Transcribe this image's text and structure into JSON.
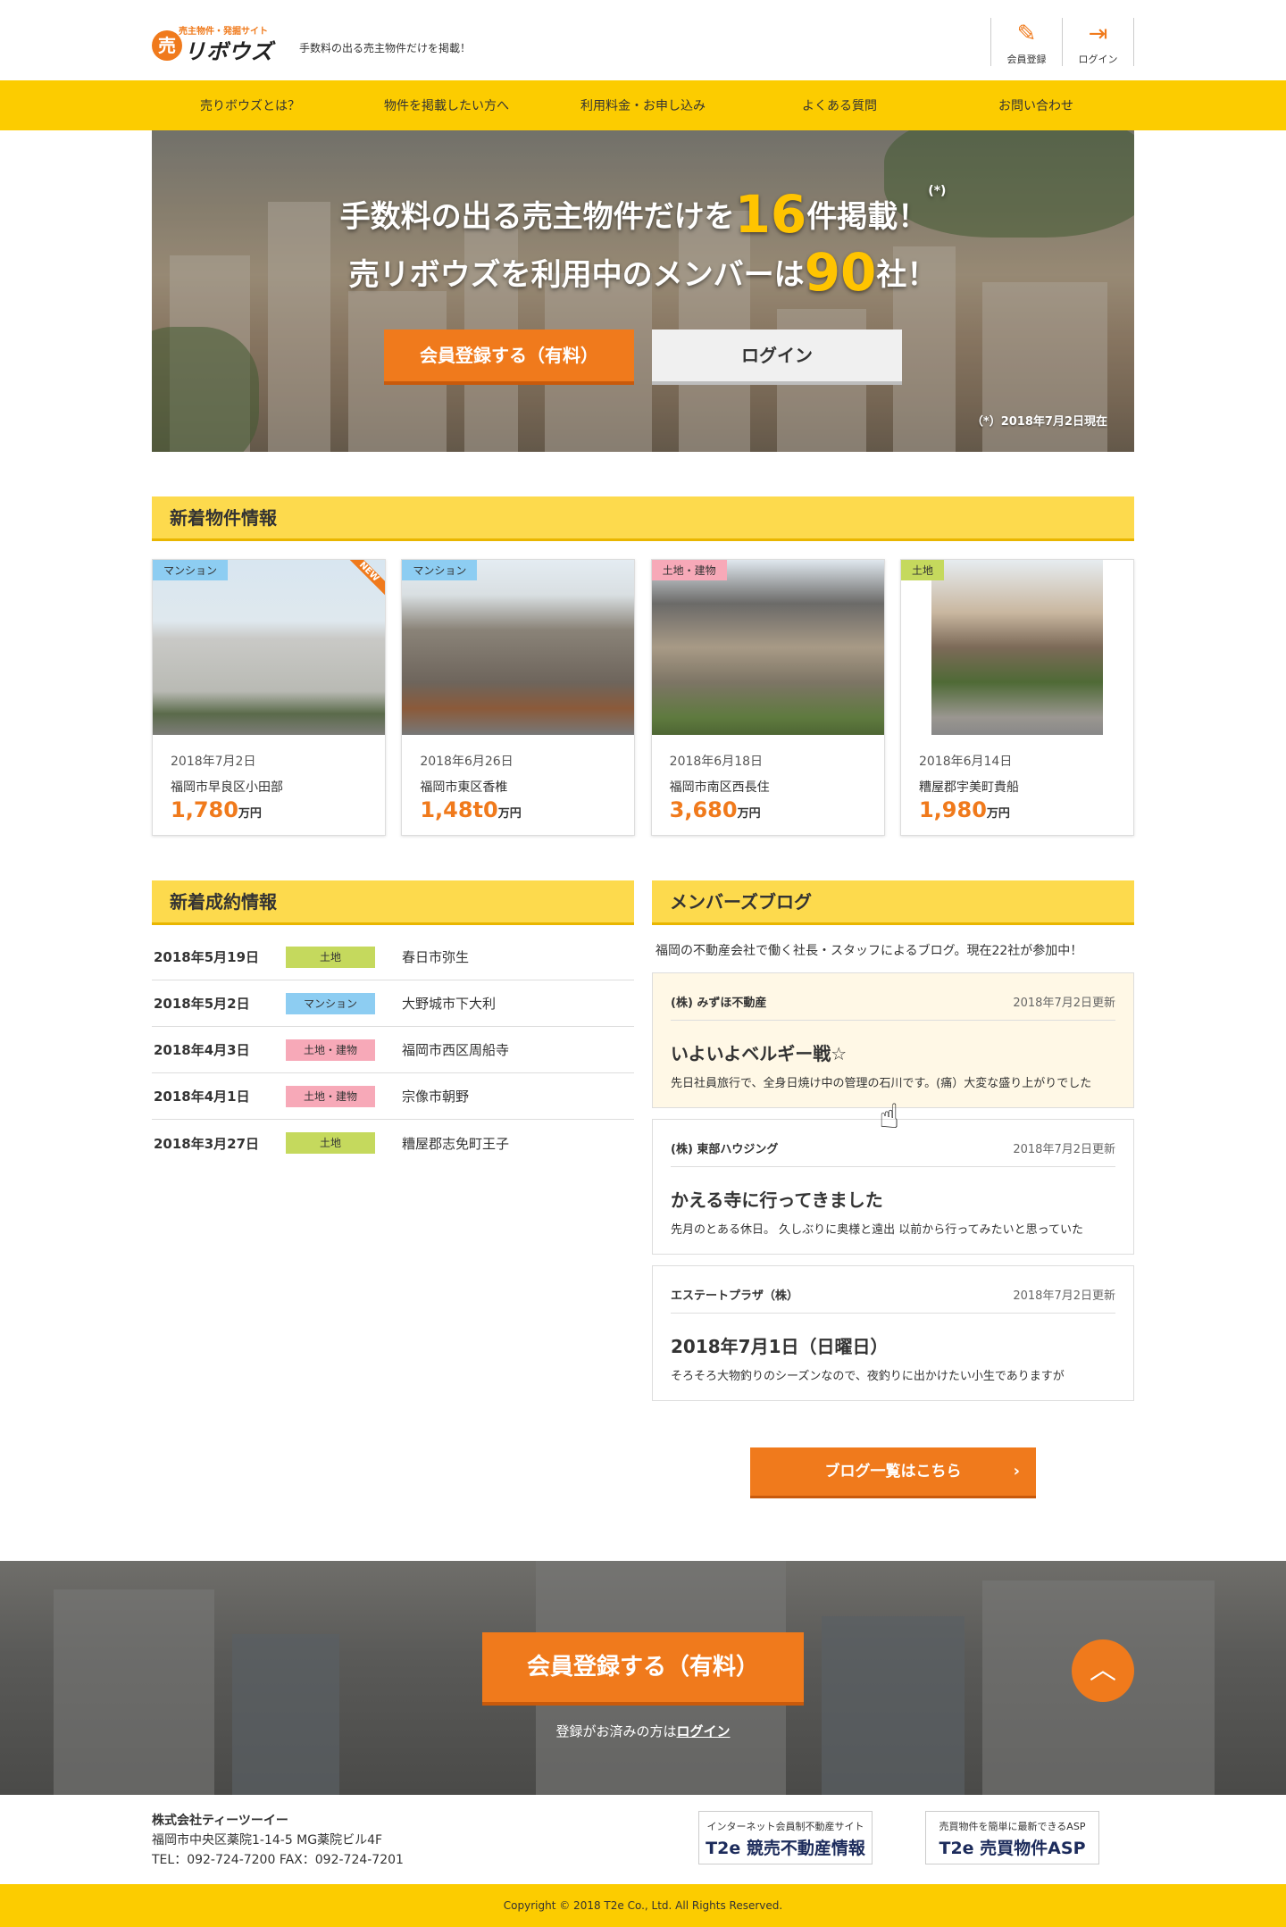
{
  "header": {
    "logo_small": "売主物件・発掘サイト",
    "logo_mark": "売",
    "logo_text": "リボウズ",
    "tagline": "手数料の出る売主物件だけを掲載！",
    "register_label": "会員登録",
    "login_label": "ログイン"
  },
  "nav": {
    "items": [
      "売りボウズとは？",
      "物件を掲載したい方へ",
      "利用料金・お申し込み",
      "よくある質問",
      "お問い合わせ"
    ]
  },
  "hero": {
    "line1_a": "手数料の出る売主物件だけを",
    "line1_num": "16",
    "line1_b": "件掲載！",
    "line1_ast": "(*)",
    "line2_a": "売リボウズを利用中のメンバーは",
    "line2_num": "90",
    "line2_b": "社！",
    "register_button": "会員登録する（有料）",
    "login_button": "ログイン",
    "note": "（*）2018年7月2日現在"
  },
  "new_properties": {
    "title": "新着物件情報",
    "new_badge": "NEW",
    "unit": "万円",
    "items": [
      {
        "tag": "マンション",
        "date": "2018年7月2日",
        "address": "福岡市早良区小田部",
        "price": "1,780"
      },
      {
        "tag": "マンション",
        "date": "2018年6月26日",
        "address": "福岡市東区香椎",
        "price": "1,48t0"
      },
      {
        "tag": "土地・建物",
        "date": "2018年6月18日",
        "address": "福岡市南区西長住",
        "price": "3,680"
      },
      {
        "tag": "土地",
        "date": "2018年6月14日",
        "address": "糟屋郡宇美町貴船",
        "price": "1,980"
      }
    ]
  },
  "deals": {
    "title": "新着成約情報",
    "items": [
      {
        "date": "2018年5月19日",
        "tag": "土地",
        "city": "春日市弥生"
      },
      {
        "date": "2018年5月2日",
        "tag": "マンション",
        "city": "大野城市下大利"
      },
      {
        "date": "2018年4月3日",
        "tag": "土地・建物",
        "city": "福岡市西区周船寺"
      },
      {
        "date": "2018年4月1日",
        "tag": "土地・建物",
        "city": "宗像市朝野"
      },
      {
        "date": "2018年3月27日",
        "tag": "土地",
        "city": "糟屋郡志免町王子"
      }
    ]
  },
  "blog": {
    "title": "メンバーズブログ",
    "description": "福岡の不動産会社で働く社長・スタッフによるブログ。現在22社が参加中！",
    "posts": [
      {
        "author": "(株) みずほ不動産",
        "date": "2018年7月2日更新",
        "title": "いよいよベルギー戦☆",
        "excerpt": "先日社員旅行で、全身日焼け中の管理の石川です。(痛）大変な盛り上がりでした"
      },
      {
        "author": "(株) 東部ハウジング",
        "date": "2018年7月2日更新",
        "title": "かえる寺に行ってきました",
        "excerpt": "先月のとある休日。 久しぶりに奥様と遠出 以前から行ってみたいと思っていた"
      },
      {
        "author": "エステートプラザ（株）",
        "date": "2018年7月2日更新",
        "title": "2018年7月1日（日曜日）",
        "excerpt": "そろそろ大物釣りのシーズンなので、夜釣りに出かけたい小生でありますが"
      }
    ],
    "list_button": "ブログ一覧はこちら",
    "arrow": "›"
  },
  "cta": {
    "register_button": "会員登録する（有料）",
    "sub_text": "登録がお済みの方は",
    "sub_link": "ログイン",
    "to_top": "︿"
  },
  "footer": {
    "company": "株式会社ティーツーイー",
    "address": "福岡市中央区薬院1-14-5 MG薬院ビル4F",
    "tel": "TEL：092-724-7200 FAX：092-724-7201",
    "banner1_small": "インターネット会員制不動産サイト",
    "banner1_big": "T2e 競売不動産情報",
    "banner2_small": "売買物件を簡単に最新できるASP",
    "banner2_big": "T2e 売買物件ASP",
    "copyright": "Copyright © 2018 T2e Co., Ltd. All Rights Reserved."
  },
  "colors": {
    "accent": "#f07a1c",
    "nav_bg": "#fccc00",
    "title_bg": "#fdda4d"
  }
}
